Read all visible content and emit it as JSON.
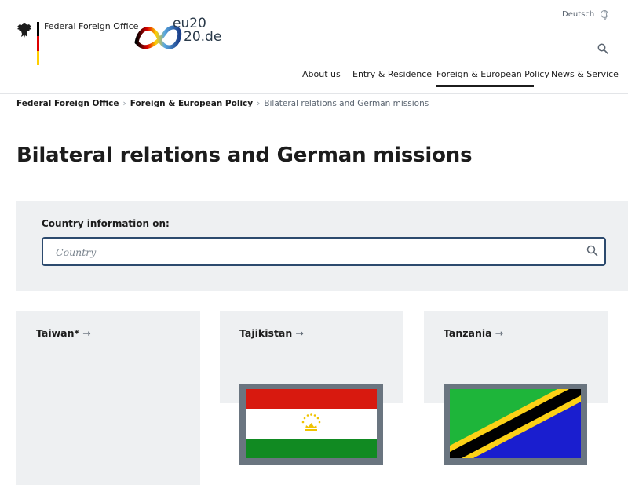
{
  "header": {
    "org_name": "Federal Foreign Office",
    "eu_logo_line1": "eu20",
    "eu_logo_line2": "20.de",
    "language": "Deutsch",
    "flag_colors": [
      "#000000",
      "#dd0000",
      "#ffce00"
    ],
    "nav": [
      {
        "label": "About us",
        "active": false
      },
      {
        "label": "Entry & Residence",
        "active": false
      },
      {
        "label": "Foreign & European Policy",
        "active": true
      },
      {
        "label": "News & Service",
        "active": false
      }
    ]
  },
  "breadcrumb": [
    {
      "label": "Federal Foreign Office",
      "link": true
    },
    {
      "label": "Foreign & European Policy",
      "link": true
    },
    {
      "label": "Bilateral relations and German missions",
      "link": false
    }
  ],
  "page_title": "Bilateral relations and German missions",
  "search": {
    "label": "Country information on:",
    "placeholder": "Country",
    "value": ""
  },
  "cards": [
    {
      "name": "Taiwan*",
      "arrow": "→",
      "flag": null
    },
    {
      "name": "Tajikistan",
      "arrow": "→",
      "flag": "tajikistan-flag"
    },
    {
      "name": "Tanzania",
      "arrow": "→",
      "flag": "tanzania-flag"
    }
  ],
  "colors": {
    "panel_bg": "#eef0f2",
    "search_border": "#2c4a6e",
    "active_underline": "#1c1c1c"
  }
}
